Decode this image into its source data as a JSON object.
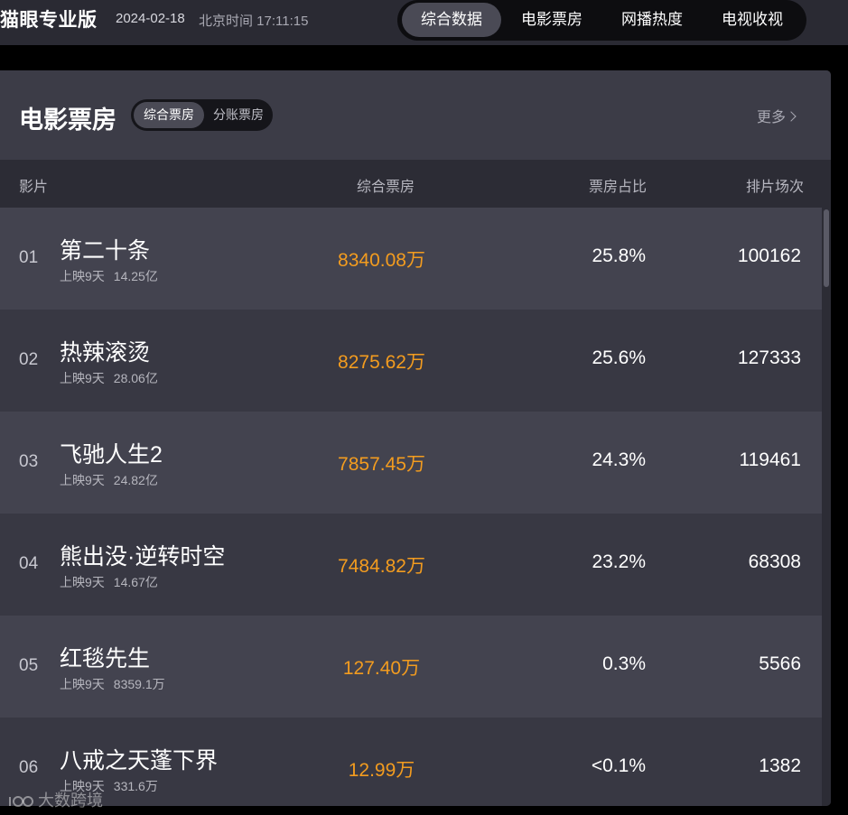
{
  "header": {
    "brand": "猫眼专业版",
    "date": "2024-02-18",
    "clock": "北京时间 17:11:15",
    "nav": [
      {
        "label": "综合数据",
        "active": true
      },
      {
        "label": "电影票房",
        "active": false
      },
      {
        "label": "网播热度",
        "active": false
      },
      {
        "label": "电视收视",
        "active": false
      }
    ]
  },
  "panel": {
    "title": "电影票房",
    "subtabs": [
      {
        "label": "综合票房",
        "active": true
      },
      {
        "label": "分账票房",
        "active": false
      }
    ],
    "more_label": "更多"
  },
  "table": {
    "columns": [
      "影片",
      "综合票房",
      "票房占比",
      "排片场次"
    ],
    "rows": [
      {
        "rank": "01",
        "name": "第二十条",
        "days": "上映9天",
        "total": "14.25亿",
        "box": "8340.08万",
        "share": "25.8%",
        "shows": "100162"
      },
      {
        "rank": "02",
        "name": "热辣滚烫",
        "days": "上映9天",
        "total": "28.06亿",
        "box": "8275.62万",
        "share": "25.6%",
        "shows": "127333"
      },
      {
        "rank": "03",
        "name": "飞驰人生2",
        "days": "上映9天",
        "total": "24.82亿",
        "box": "7857.45万",
        "share": "24.3%",
        "shows": "119461"
      },
      {
        "rank": "04",
        "name": "熊出没·逆转时空",
        "days": "上映9天",
        "total": "14.67亿",
        "box": "7484.82万",
        "share": "23.2%",
        "shows": "68308"
      },
      {
        "rank": "05",
        "name": "红毯先生",
        "days": "上映9天",
        "total": "8359.1万",
        "box": "127.40万",
        "share": "0.3%",
        "shows": "5566"
      },
      {
        "rank": "06",
        "name": "八戒之天蓬下界",
        "days": "上映9天",
        "total": "331.6万",
        "box": "12.99万",
        "share": "<0.1%",
        "shows": "1382"
      }
    ]
  },
  "watermark": "大数跨境",
  "colors": {
    "box_office": "#f39c1f",
    "panel_bg": "#2c2c35",
    "row_odd": "#43434f",
    "row_even": "#383843"
  }
}
